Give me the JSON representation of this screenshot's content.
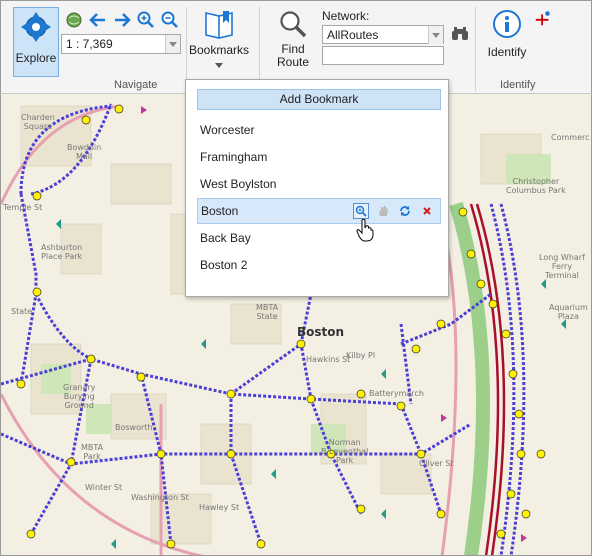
{
  "ribbon": {
    "explore_label": "Explore",
    "scale_value": "1 : 7,369",
    "bookmarks_label": "Bookmarks",
    "find_route_label_1": "Find",
    "find_route_label_2": "Route",
    "network_label": "Network:",
    "network_value": "AllRoutes",
    "identify_label": "Identify",
    "group_navigate": "Navigate",
    "group_identify": "Identify"
  },
  "bookmarks": {
    "add_label": "Add Bookmark",
    "items": [
      "Worcester",
      "Framingham",
      "West Boylston",
      "Boston",
      "Back Bay",
      "Boston 2"
    ],
    "selected_index": 3
  },
  "map": {
    "labels": {
      "charden": "Charden\nSquare",
      "bowdoin": "Bowdoin\nMall",
      "ashburton": "Ashburton\nPlace Park",
      "state": "State",
      "mbta_state": "MBTA\nState",
      "boston": "Boston",
      "granary": "Granary\nBurying\nGround",
      "mbta_park": "MBTA\nPark",
      "norman": "Norman\nB Leventhal\nPark",
      "christopher": "Christopher\nColumbus Park",
      "long_wharf": "Long Wharf\nFerry\nTerminal",
      "aquarium": "Aquarium\nPlaza",
      "commercial": "Commerc",
      "hawkins": "Hawkins St",
      "kilby": "Kilby Pl",
      "batterymarch": "Batterymarch",
      "winter": "Winter St",
      "washington": "Washington St",
      "hawley": "Hawley St",
      "oliver": "Oliver St",
      "bosworth": "Bosworth",
      "temple": "Temple St"
    }
  },
  "colors": {
    "accent": "#cfe3f7",
    "route": "#4b3fd6",
    "stop": "#fff200",
    "road_pink": "#e7a0b0"
  }
}
